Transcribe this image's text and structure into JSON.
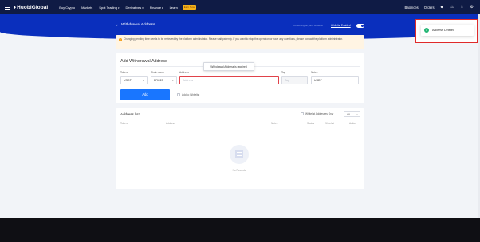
{
  "nav": {
    "logo_text": "HuobiGlobal",
    "items": [
      {
        "label": "Buy Crypto",
        "dropdown": false
      },
      {
        "label": "Markets",
        "dropdown": false
      },
      {
        "label": "Spot Trading",
        "dropdown": true
      },
      {
        "label": "Derivatives",
        "dropdown": true
      },
      {
        "label": "Finance",
        "dropdown": true
      },
      {
        "label": "Learn",
        "dropdown": false
      }
    ],
    "badge": "Earn Now",
    "right_items": [
      "Balances",
      "Orders"
    ],
    "icons": [
      "user-icon",
      "bell-icon",
      "download-icon",
      "settings-icon"
    ]
  },
  "banner": {
    "back_label": "<",
    "title": "Withdrawal Address",
    "note": "On turning on, only whitelist",
    "whitelist_label": "Whitelist Enabled"
  },
  "notice": {
    "text": "Changing pending time needs to be reviewed by the platform administrator. Please wait patiently. If you want to stop the operation or have any questions, please contact the platform administrator."
  },
  "add_form": {
    "title": "Add Withdrawal Address",
    "token_label": "Tokens",
    "token_value": "USDT",
    "chain_label": "Chain name",
    "chain_value": "ERC20",
    "address_label": "Address",
    "address_placeholder": "Address",
    "tag_label": "Tag",
    "tag_placeholder": "Tag",
    "notes_label": "Notes",
    "notes_value": "USDT",
    "error_tooltip": "Withdrawal Address is required",
    "add_button": "Add",
    "whitelist_checkbox_label": "Add to Whitelist"
  },
  "address_list": {
    "title": "Address list",
    "whitelist_only_label": "Whitelist Addresses Only",
    "filter_value": "All",
    "columns": [
      "Tokens",
      "Address",
      "Notes",
      "Status",
      "Whitelist",
      "Action"
    ],
    "empty_text": "No Records"
  },
  "toast": {
    "message": "Address Deleted",
    "status_color": "#22b573"
  }
}
